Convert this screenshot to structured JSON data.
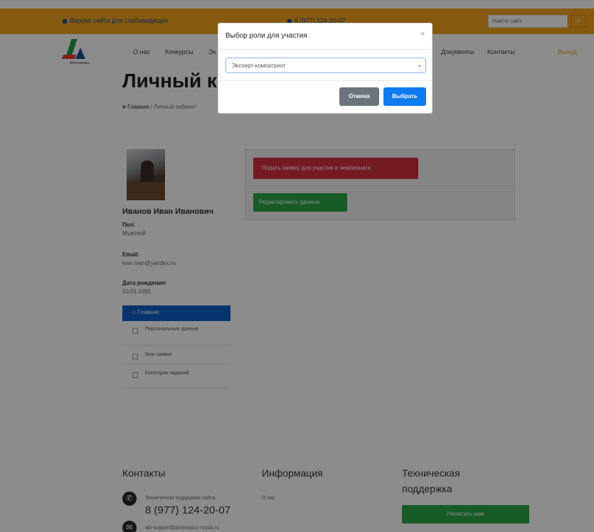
{
  "topbar": {
    "announcement": "Версия сайта для слабовидящих",
    "phone": "8 (977) 124-20-07",
    "search_placeholder": "Найти сайт",
    "search_icon": "magnifier-icon"
  },
  "logo": {
    "text": "Абилимпикс"
  },
  "nav": {
    "items": [
      "О нас",
      "Конкурсы",
      "Эк",
      "Документы",
      "Контакты"
    ],
    "login": "Выход"
  },
  "page": {
    "title": "Личный к",
    "breadcrumb_home": "Главная",
    "breadcrumb_current": "Личный кабинет"
  },
  "profile": {
    "name": "Иванов Иван Иванович",
    "fields": [
      {
        "label": "Пол:",
        "value": "Мужской"
      },
      {
        "label": "Email:",
        "value": "ivan.ivan@yandex.ru"
      },
      {
        "label": "Дата рождения:",
        "value": "10.01.1991"
      }
    ],
    "menu": [
      {
        "label": "Главная",
        "active": true,
        "icon": "home-icon"
      },
      {
        "label": "Персональные данные",
        "active": false,
        "icon": "user-icon"
      },
      {
        "label": "Мои заявки",
        "active": false,
        "icon": "list-icon"
      },
      {
        "label": "Категории заданий",
        "active": false,
        "icon": "grid-icon"
      }
    ]
  },
  "main": {
    "apply_button": "Подать заявку для участия в чемпионате",
    "edit_button": "Редактировать данные"
  },
  "footer": {
    "contacts": {
      "title": "Контакты",
      "support_label": "Техническая поддержка сайта",
      "phone": "8 (977) 124-20-07",
      "email": "abi-support@abilympics-russia.ru"
    },
    "info": {
      "title": "Информация",
      "item": "О нас"
    },
    "support": {
      "title_line1": "Техническая",
      "title_line2": "поддержка",
      "button": "Написать нам"
    }
  },
  "modal": {
    "title": "Выбор роли для участия",
    "close": "×",
    "select_value": "Эксперт-компатриот",
    "cancel": "Отмена",
    "confirm": "Выбрать"
  },
  "colors": {
    "topbar": "#f3a41b",
    "primary": "#0d7bf2",
    "danger": "#d3313d",
    "success": "#2aa745",
    "secondary": "#6c757d"
  }
}
